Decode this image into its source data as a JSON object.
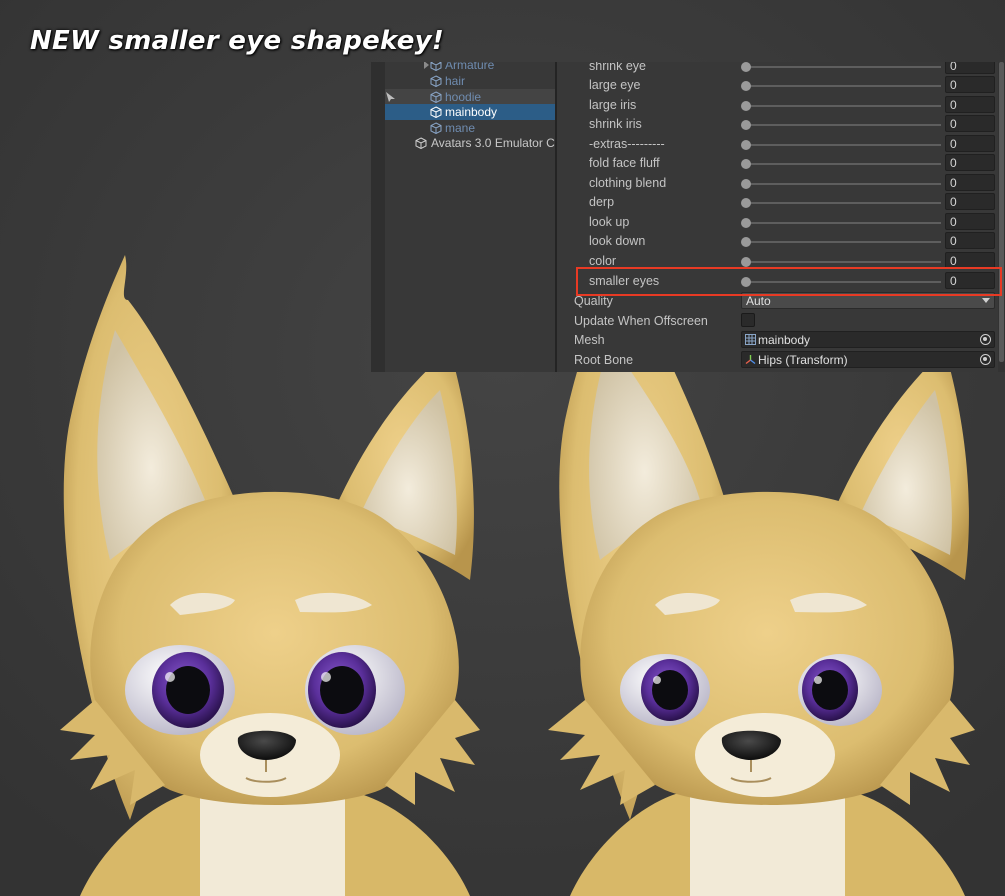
{
  "headline": "NEW smaller eye shapekey!",
  "hierarchy": {
    "items": [
      {
        "label": "Armature",
        "state": "dim"
      },
      {
        "label": "hair",
        "state": "dim"
      },
      {
        "label": "hoodie",
        "state": "hover"
      },
      {
        "label": "mainbody",
        "state": "selected"
      },
      {
        "label": "mane",
        "state": "dim"
      },
      {
        "label": "Avatars 3.0 Emulator C",
        "state": "normal"
      }
    ]
  },
  "blendshapes": [
    {
      "name": "shrink eye",
      "value": "0"
    },
    {
      "name": "large eye",
      "value": "0"
    },
    {
      "name": "large iris",
      "value": "0"
    },
    {
      "name": "shrink iris",
      "value": "0"
    },
    {
      "name": "-extras---------",
      "value": "0"
    },
    {
      "name": "fold face fluff",
      "value": "0"
    },
    {
      "name": "clothing blend",
      "value": "0"
    },
    {
      "name": "derp",
      "value": "0"
    },
    {
      "name": "look up",
      "value": "0"
    },
    {
      "name": "look down",
      "value": "0"
    },
    {
      "name": "color",
      "value": "0"
    },
    {
      "name": "smaller eyes",
      "value": "0"
    }
  ],
  "properties": {
    "quality_label": "Quality",
    "quality_value": "Auto",
    "offscreen_label": "Update When Offscreen",
    "offscreen_checked": false,
    "mesh_label": "Mesh",
    "mesh_value": "mainbody",
    "rootbone_label": "Root Bone",
    "rootbone_value": "Hips (Transform)"
  },
  "colors": {
    "highlight_border": "#e83a24",
    "selection": "#2c5d87",
    "fur": "#e4c67a",
    "iris": "#5a2f9a"
  }
}
